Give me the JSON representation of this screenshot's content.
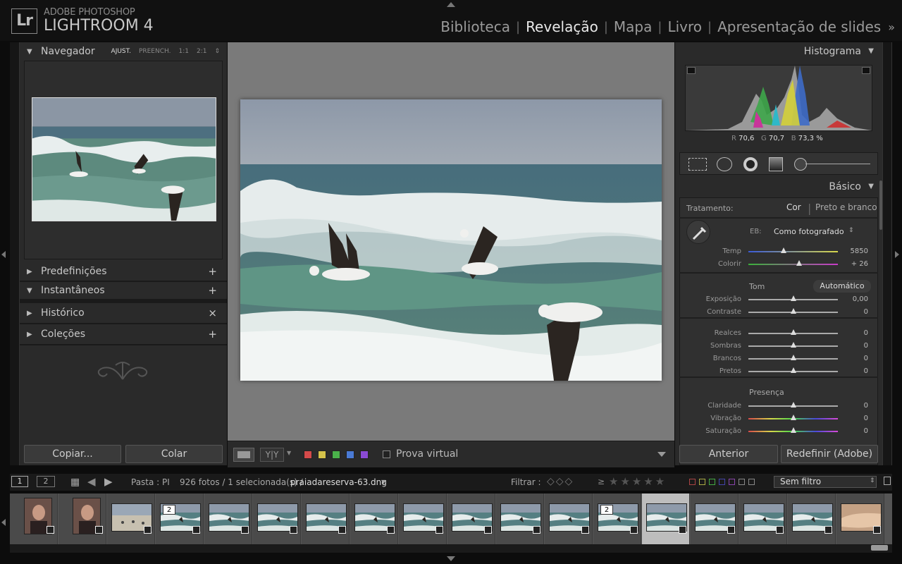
{
  "app": {
    "badge": "Lr",
    "brand_top": "ADOBE PHOTOSHOP",
    "brand_main": "LIGHTROOM 4"
  },
  "modules": [
    {
      "label": "Biblioteca",
      "active": false
    },
    {
      "label": "Revelação",
      "active": true
    },
    {
      "label": "Mapa",
      "active": false
    },
    {
      "label": "Livro",
      "active": false
    },
    {
      "label": "Apresentação de slides",
      "active": false
    }
  ],
  "modules_more": "»",
  "left": {
    "navigator": {
      "title": "Navegador",
      "options": [
        "AJUST.",
        "PREENCH.",
        "1:1",
        "2:1"
      ],
      "options_more": "⇕"
    },
    "panels": [
      {
        "title": "Predefinições",
        "action": "+"
      },
      {
        "title": "Instantâneos",
        "action": "+"
      },
      {
        "title": "Histórico",
        "action": "×"
      },
      {
        "title": "Coleções",
        "action": "+"
      }
    ],
    "copy_label": "Copiar...",
    "paste_label": "Colar"
  },
  "toolbar": {
    "color_labels": [
      "#d44a4a",
      "#d4c24a",
      "#4ab04a",
      "#4a7ad4",
      "#8a4ad4"
    ],
    "soft_proof_label": "Prova virtual"
  },
  "right": {
    "histogram": {
      "title": "Histograma",
      "r_label": "R",
      "r": "70,6",
      "g_label": "G",
      "g": "70,7",
      "b_label": "B",
      "b": "73,3",
      "unit": "%"
    },
    "basic": {
      "title": "Básico",
      "treatment_label": "Tratamento:",
      "treatment_color": "Cor",
      "treatment_bw": "Preto e branco",
      "wb_label": "EB:",
      "wb_value": "Como fotografado",
      "tone_label": "Tom",
      "auto_label": "Automático",
      "presence_label": "Presença",
      "sliders": [
        {
          "label": "Temp",
          "value": "5850",
          "pos": 0.39
        },
        {
          "label": "Colorir",
          "value": "+ 26",
          "pos": 0.57
        },
        {
          "label": "Exposição",
          "value": "0,00",
          "pos": 0.5
        },
        {
          "label": "Contraste",
          "value": "0",
          "pos": 0.5
        },
        {
          "label": "Realces",
          "value": "0",
          "pos": 0.5
        },
        {
          "label": "Sombras",
          "value": "0",
          "pos": 0.5
        },
        {
          "label": "Brancos",
          "value": "0",
          "pos": 0.5
        },
        {
          "label": "Pretos",
          "value": "0",
          "pos": 0.5
        },
        {
          "label": "Claridade",
          "value": "0",
          "pos": 0.5
        },
        {
          "label": "Vibração",
          "value": "0",
          "pos": 0.5
        },
        {
          "label": "Saturação",
          "value": "0",
          "pos": 0.5
        }
      ]
    },
    "prev_label": "Anterior",
    "reset_label": "Redefinir (Adobe)"
  },
  "filmstrip": {
    "view1": "1",
    "view2": "2",
    "source_prefix": "Pasta : PI",
    "count_text": "926 fotos / 1 selecionada(s) /",
    "filename": "praiadareserva-63.dng",
    "filter_label": "Filtrar :",
    "rating_op": "≥",
    "filter_value": "Sem filtro",
    "thumbs": [
      {
        "kind": "portrait",
        "stack": ""
      },
      {
        "kind": "portrait",
        "stack": ""
      },
      {
        "kind": "beach",
        "stack": ""
      },
      {
        "kind": "wave",
        "stack": "2"
      },
      {
        "kind": "wave",
        "stack": ""
      },
      {
        "kind": "wave",
        "stack": ""
      },
      {
        "kind": "wave",
        "stack": ""
      },
      {
        "kind": "wave",
        "stack": ""
      },
      {
        "kind": "wave",
        "stack": ""
      },
      {
        "kind": "wave",
        "stack": ""
      },
      {
        "kind": "wave",
        "stack": ""
      },
      {
        "kind": "wave",
        "stack": ""
      },
      {
        "kind": "wave",
        "stack": "2"
      },
      {
        "kind": "wave",
        "stack": "",
        "selected": true
      },
      {
        "kind": "wave",
        "stack": ""
      },
      {
        "kind": "wave",
        "stack": ""
      },
      {
        "kind": "wave",
        "stack": ""
      },
      {
        "kind": "hand",
        "stack": ""
      }
    ]
  }
}
